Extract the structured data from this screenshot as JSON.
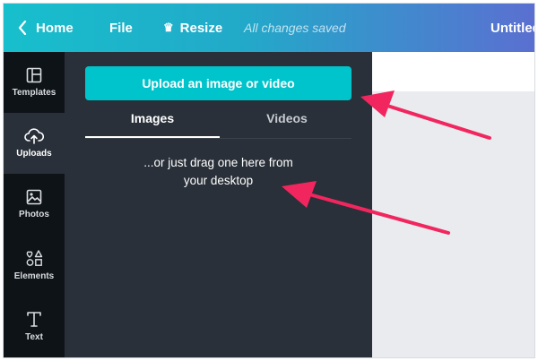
{
  "topbar": {
    "home_label": "Home",
    "file_label": "File",
    "resize_label": "Resize",
    "saved_status": "All changes saved",
    "doc_title": "Untitled"
  },
  "rail": {
    "items": [
      {
        "label": "Templates"
      },
      {
        "label": "Uploads"
      },
      {
        "label": "Photos"
      },
      {
        "label": "Elements"
      },
      {
        "label": "Text"
      }
    ],
    "active": "Uploads"
  },
  "panel": {
    "upload_button": "Upload an image or video",
    "tabs": [
      {
        "label": "Images",
        "active": true
      },
      {
        "label": "Videos",
        "active": false
      }
    ],
    "hint_line1": "...or just drag one here from",
    "hint_line2": "your desktop"
  },
  "colors": {
    "accent": "#00c4cc",
    "panel_bg": "#293039",
    "rail_bg": "#0e1318",
    "arrow": "#f2265e"
  },
  "icons": [
    "chevron-left-icon",
    "crown-icon",
    "templates-icon",
    "upload-cloud-icon",
    "photos-icon",
    "elements-icon",
    "text-icon"
  ]
}
